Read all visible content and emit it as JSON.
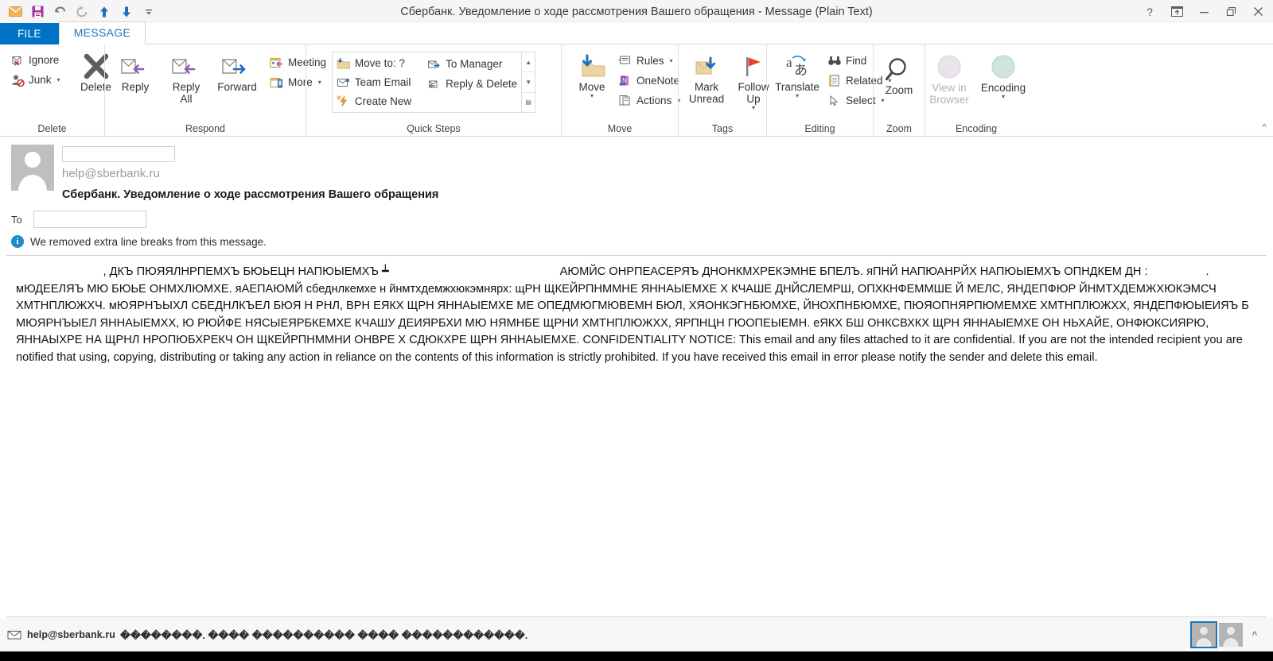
{
  "window": {
    "title": "Сбербанк. Уведомление о ходе рассмотрения Вашего обращения - Message (Plain Text)",
    "quick_access": [
      {
        "name": "mail-icon",
        "glyph": "✉"
      },
      {
        "name": "save-icon",
        "glyph": "ὋE"
      },
      {
        "name": "undo-icon",
        "glyph": "↶"
      },
      {
        "name": "redo-icon",
        "glyph": "↻"
      },
      {
        "name": "previous-item-icon",
        "glyph": "↑"
      },
      {
        "name": "next-item-icon",
        "glyph": "↓"
      },
      {
        "name": "customize-qat-icon",
        "glyph": "⌄"
      }
    ],
    "controls": {
      "help": "?",
      "ribbon_display": "⇱",
      "minimize": "—",
      "restore": "❐",
      "close": "✕"
    }
  },
  "tabs": {
    "file": "FILE",
    "message": "MESSAGE"
  },
  "ribbon": {
    "collapse_label": "^",
    "groups": [
      {
        "label": "Delete",
        "small_buttons": [
          {
            "label": "Ignore",
            "icon": "ignore-icon",
            "caret": false
          },
          {
            "label": "Junk",
            "icon": "junk-icon",
            "caret": true
          }
        ],
        "large_buttons": [
          {
            "label": "Delete",
            "icon": "delete-x-icon"
          }
        ]
      },
      {
        "label": "Respond",
        "large_buttons": [
          {
            "label": "Reply",
            "icon": "reply-icon"
          },
          {
            "label": "Reply All",
            "icon": "reply-all-icon"
          },
          {
            "label": "Forward",
            "icon": "forward-icon"
          }
        ],
        "small_buttons": [
          {
            "label": "Meeting",
            "icon": "meeting-icon",
            "caret": false
          },
          {
            "label": "More",
            "icon": "more-icon",
            "caret": true
          }
        ]
      },
      {
        "label": "Quick Steps",
        "has_launcher": true,
        "quick_steps_col1": [
          {
            "label": "Move to: ?",
            "icon": "move-to-folder-icon"
          },
          {
            "label": "Team Email",
            "icon": "team-email-icon"
          },
          {
            "label": "Create New",
            "icon": "create-new-icon"
          }
        ],
        "quick_steps_col2": [
          {
            "label": "To Manager",
            "icon": "to-manager-icon"
          },
          {
            "label": "Reply & Delete",
            "icon": "reply-delete-icon"
          }
        ],
        "scroll": [
          "▲",
          "▼",
          "▤"
        ]
      },
      {
        "label": "Move",
        "large_buttons": [
          {
            "label": "Move",
            "icon": "move-folder-icon",
            "caret": true
          }
        ],
        "small_buttons": [
          {
            "label": "Rules",
            "icon": "rules-icon",
            "caret": true
          },
          {
            "label": "OneNote",
            "icon": "onenote-icon",
            "caret": false
          },
          {
            "label": "Actions",
            "icon": "actions-icon",
            "caret": true
          }
        ]
      },
      {
        "label": "Tags",
        "has_launcher": true,
        "large_buttons": [
          {
            "label": "Mark Unread",
            "icon": "mark-unread-icon"
          },
          {
            "label": "Follow Up",
            "icon": "follow-up-flag-icon",
            "caret": true
          }
        ]
      },
      {
        "label": "Editing",
        "large_buttons": [
          {
            "label": "Translate",
            "icon": "translate-icon",
            "caret": true
          }
        ],
        "small_buttons": [
          {
            "label": "Find",
            "icon": "find-binoculars-icon",
            "caret": false
          },
          {
            "label": "Related",
            "icon": "related-icon",
            "caret": true
          },
          {
            "label": "Select",
            "icon": "select-cursor-icon",
            "caret": true
          }
        ]
      },
      {
        "label": "Zoom",
        "large_buttons": [
          {
            "label": "Zoom",
            "icon": "zoom-magnifier-icon"
          }
        ]
      },
      {
        "label": "Encoding",
        "large_buttons": [
          {
            "label": "View in Browser",
            "icon": "view-in-browser-icon",
            "disabled": true
          },
          {
            "label": "Encoding",
            "icon": "encoding-icon",
            "caret": true
          }
        ]
      }
    ]
  },
  "message": {
    "sender_name_redacted": true,
    "from_address": "help@sberbank.ru",
    "subject": "Сбербанк. Уведомление о ходе рассмотрения Вашего обращения",
    "to_label": "To",
    "to_redacted": true,
    "info_bar": "We removed extra line breaks from this message.",
    "body": "                           , ДКЪ ПЮЯЯЛНРПЕМХЪ БЮЬЕЦН НАПЮЫЕМХЪ ┷                                                     АЮМЙС ОНРПЕАСЕРЯЪ ДНОНКМХРЕКЭМНЕ БПЕЛЪ. яПНЙ НАПЮАНРЙХ НАПЮЫЕМХЪ ОПНДКЕМ ДН :                  . мЮДЕЕЛЯЪ МЮ БЮЬЕ ОНМХЛЮМХЕ. яАЕПАЮМЙ сбеднлкемхе н йнмтхдемжхюкэмнярх: щРН ЩКЕЙРПНММНЕ ЯННАЫЕМХЕ Х КЧАШЕ ДНЙСЛЕМРШ, ОПХКНФЕММШЕ Й МЕЛС, ЯНДЕПФЮР ЙНМТХДЕМЖХЮКЭМСЧ ХМТНПЛЮЖХЧ. мЮЯРНЪЫХЛ СБЕДНЛКЪЕЛ БЮЯ Н РНЛ, ВРН ЕЯКХ ЩРН ЯННАЫЕМХЕ МЕ ОПЕДМЮГМЮВЕМН БЮЛ, ХЯОНКЭГНБЮМХЕ, ЙНОХПНБЮМХЕ, ПЮЯОПНЯРПЮМЕМХЕ ХМТНПЛЮЖХХ, ЯНДЕПФЮЫЕИЯЪ Б МЮЯРНЪЫЕЛ ЯННАЫЕМХХ, Ю РЮЙФЕ НЯСЫЕЯРБКЕМХЕ КЧАШУ ДЕИЯРБХИ МЮ НЯМНБЕ ЩРНИ ХМТНПЛЮЖХХ, ЯРПНЦН ГЮОПЕЫЕМН. еЯКХ БШ ОНКСВХКХ ЩРН ЯННАЫЕМХЕ ОН НЬХАЙЕ, ОНФЮКСИЯРЮ, ЯННАЫХРЕ НА ЩРНЛ НРОПЮБХРЕКЧ ОН ЩКЕЙРПНММНИ ОНВРЕ Х СДЮКХРЕ ЩРН ЯННАЫЕМХЕ. CONFIDENTIALITY NOTICE: This email and any files attached to it are confidential. If you are not the intended recipient you are notified that using, copying, distributing or taking any action in reliance on the contents of this information is strictly prohibited. If you have received this email in error please notify the sender and delete this email."
  },
  "status": {
    "sender": "help@sberbank.ru",
    "detail": "��������. ���� ���������� ���� ������������.",
    "collapse_glyph": "^"
  },
  "colors": {
    "file_tab": "#0072c6",
    "active_tab_text": "#1a75bb",
    "info_icon": "#1e8bcd",
    "folder_tan": "#edd5a3",
    "flag_red": "#e8402a",
    "arrow_purple": "#8a5fb5",
    "arrow_blue": "#1f6fbf"
  }
}
